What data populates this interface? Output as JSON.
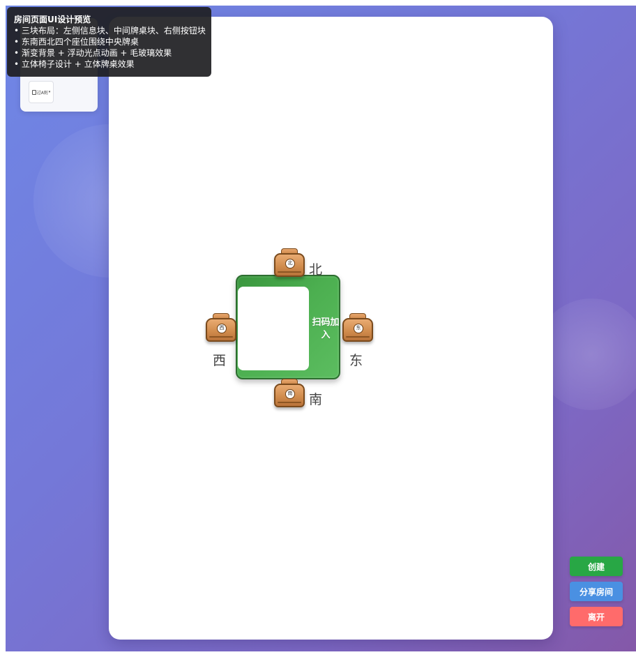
{
  "overlay": {
    "title": "房间页面UI设计预览",
    "lines": [
      "• 三块布局：左侧信息块、中间牌桌块、右侧按钮块",
      "• 东南西北四个座位围绕中央牌桌",
      "• 渐变背景 + 浮动光点动画 + 毛玻璃效果",
      "• 立体椅子设计 + 立体牌桌效果"
    ]
  },
  "left_panel": {
    "chip_label": "过A则"
  },
  "table": {
    "scan_label": "扫码加入"
  },
  "seats": {
    "north": {
      "label": "北",
      "badge": "北"
    },
    "south": {
      "label": "南",
      "badge": "南"
    },
    "east": {
      "label": "东",
      "badge": "东"
    },
    "west": {
      "label": "西",
      "badge": "西"
    }
  },
  "buttons": {
    "create": "创建",
    "share": "分享房间",
    "leave": "离开"
  },
  "colors": {
    "background_gradient": [
      "#6f87e6",
      "#8458a8"
    ],
    "table_green": "#4caf50",
    "chair_wood": "#cf8a4b",
    "create": "#28a745",
    "share": "#4a90e2",
    "leave": "#ff6b6b"
  }
}
